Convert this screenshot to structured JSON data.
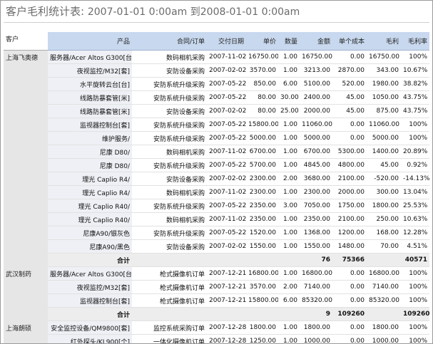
{
  "title": {
    "main": "客户毛利统计表:",
    "range": "2007-01-01 0:00am 到2008-01-01 0:00am"
  },
  "columns": [
    "客户",
    "产品",
    "合同/订单",
    "交付日期",
    "单价",
    "数量",
    "金额",
    "单个成本",
    "毛利",
    "毛利率"
  ],
  "groups": [
    {
      "customer": "上海飞奥德",
      "rows": [
        [
          "服务器/Acer Altos G300[台]",
          "数码相机采购",
          "2007-11-02",
          "16750.00",
          "1.00",
          "16750.00",
          "0.00",
          "16750.00",
          "100%"
        ],
        [
          "夜视监控/M32[套]",
          "安防设备采购",
          "2007-02-02",
          "3570.00",
          "1.00",
          "3213.00",
          "2870.00",
          "343.00",
          "10.67%"
        ],
        [
          "水平旋转云台[台]",
          "安防系统升级采购",
          "2007-05-22",
          "850.00",
          "6.00",
          "5100.00",
          "520.00",
          "1980.00",
          "38.82%"
        ],
        [
          "线路防暴套管[米]",
          "安防系统升级采购",
          "2007-05-22",
          "80.00",
          "30.00",
          "2400.00",
          "45.00",
          "1050.00",
          "43.75%"
        ],
        [
          "线路防暴套管[米]",
          "安防设备采购",
          "2007-02-02",
          "80.00",
          "25.00",
          "2000.00",
          "45.00",
          "875.00",
          "43.75%"
        ],
        [
          "监视器控制台[套]",
          "安防系统升级采购",
          "2007-05-22",
          "15800.00",
          "1.00",
          "11060.00",
          "0.00",
          "11060.00",
          "100%"
        ],
        [
          "维护服务/",
          "安防系统升级采购",
          "2007-05-22",
          "5000.00",
          "1.00",
          "5000.00",
          "0.00",
          "5000.00",
          "100%"
        ],
        [
          "尼康 D80/",
          "数码相机采购",
          "2007-11-02",
          "6700.00",
          "1.00",
          "6700.00",
          "5300.00",
          "1400.00",
          "20.89%"
        ],
        [
          "尼康 D80/",
          "安防系统升级采购",
          "2007-05-22",
          "5700.00",
          "1.00",
          "4845.00",
          "4800.00",
          "45.00",
          "0.92%"
        ],
        [
          "理光 Caplio R4/",
          "安防设备采购",
          "2007-02-02",
          "2300.00",
          "2.00",
          "3680.00",
          "2100.00",
          "-520.00",
          "-14.13%"
        ],
        [
          "理光 Caplio R4/",
          "数码相机采购",
          "2007-11-02",
          "2300.00",
          "1.00",
          "2300.00",
          "2000.00",
          "300.00",
          "13.04%"
        ],
        [
          "理光 Caplio R40/",
          "安防系统升级采购",
          "2007-05-22",
          "2350.00",
          "3.00",
          "7050.00",
          "1750.00",
          "1800.00",
          "25.53%"
        ],
        [
          "理光 Caplio R40/",
          "数码相机采购",
          "2007-11-02",
          "2350.00",
          "1.00",
          "2350.00",
          "2100.00",
          "250.00",
          "10.63%"
        ],
        [
          "尼康A90/银灰色",
          "安防系统升级采购",
          "2007-05-22",
          "1520.00",
          "1.00",
          "1368.00",
          "1200.00",
          "168.00",
          "12.28%"
        ],
        [
          "尼康A90/黑色",
          "安防设备采购",
          "2007-02-02",
          "1550.00",
          "1.00",
          "1550.00",
          "1480.00",
          "70.00",
          "4.51%"
        ]
      ],
      "subtotal": {
        "label": "合计",
        "qty": "76",
        "amount": "75366",
        "profit": "40571"
      }
    },
    {
      "customer": "武汉制药",
      "rows": [
        [
          "服务器/Acer Altos G300[台]",
          "枪式摄像机订单",
          "2007-12-21",
          "16800.00",
          "1.00",
          "16800.00",
          "0.00",
          "16800.00",
          "100%"
        ],
        [
          "夜视监控/M32[套]",
          "枪式摄像机订单",
          "2007-12-21",
          "3570.00",
          "2.00",
          "7140.00",
          "0.00",
          "7140.00",
          "100%"
        ],
        [
          "监视器控制台[套]",
          "枪式摄像机订单",
          "2007-12-21",
          "15800.00",
          "6.00",
          "85320.00",
          "0.00",
          "85320.00",
          "100%"
        ]
      ],
      "subtotal": {
        "label": "合计",
        "qty": "9",
        "amount": "109260",
        "profit": "109260"
      }
    },
    {
      "customer": "上海朗硕",
      "rows": [
        [
          "安全监控设备/QM9800[套]",
          "监控系统采购订单",
          "2007-12-28",
          "1800.00",
          "1.00",
          "1800.00",
          "0.00",
          "1800.00",
          "100%"
        ],
        [
          "红外探头/KL900[个]",
          "一体化摄像机订单",
          "2007-12-28",
          "1250.00",
          "1.00",
          "1000.00",
          "0.00",
          "1000.00",
          "100%"
        ]
      ]
    }
  ]
}
